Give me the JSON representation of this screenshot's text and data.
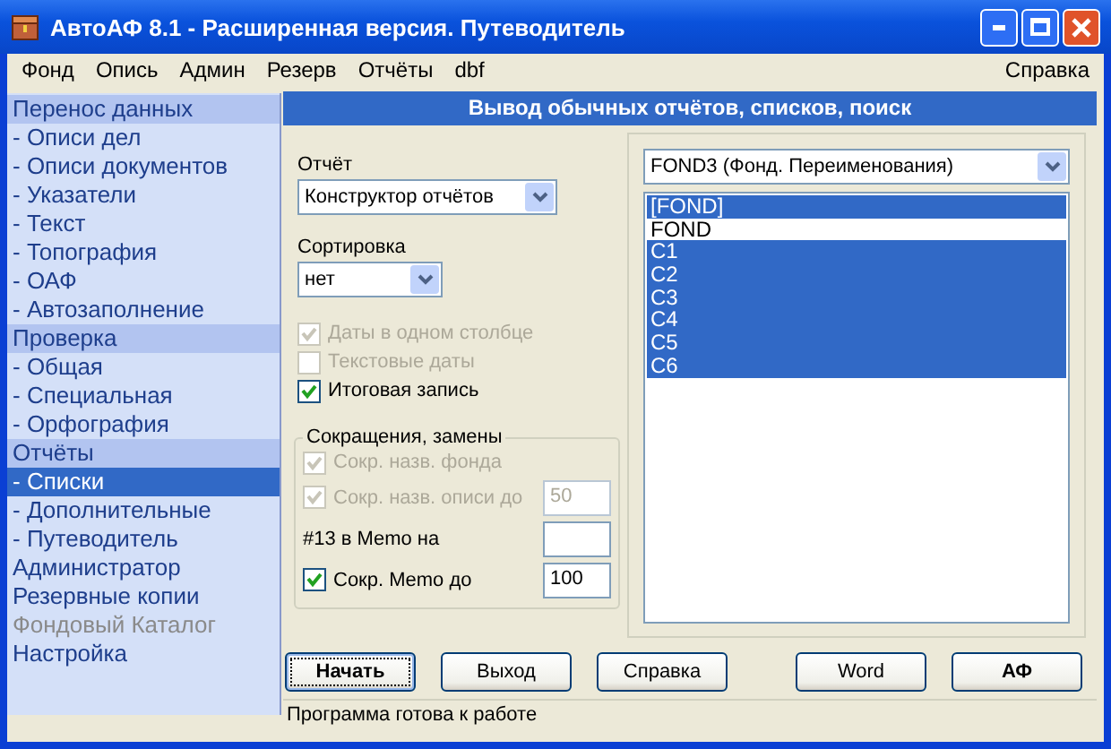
{
  "window": {
    "title": "АвтоАФ 8.1 - Расширенная версия. Путеводитель"
  },
  "menu": {
    "items": [
      "Фонд",
      "Опись",
      "Админ",
      "Резерв",
      "Отчёты",
      "dbf"
    ],
    "help": "Справка"
  },
  "sidebar": {
    "items": [
      {
        "label": "Перенос данных",
        "kind": "header",
        "selected": false,
        "disabled": false
      },
      {
        "label": "- Описи дел",
        "kind": "item",
        "selected": false,
        "disabled": false
      },
      {
        "label": "- Описи документов",
        "kind": "item",
        "selected": false,
        "disabled": false
      },
      {
        "label": "- Указатели",
        "kind": "item",
        "selected": false,
        "disabled": false
      },
      {
        "label": "- Текст",
        "kind": "item",
        "selected": false,
        "disabled": false
      },
      {
        "label": "- Топография",
        "kind": "item",
        "selected": false,
        "disabled": false
      },
      {
        "label": "- ОАФ",
        "kind": "item",
        "selected": false,
        "disabled": false
      },
      {
        "label": "- Автозаполнение",
        "kind": "item",
        "selected": false,
        "disabled": false
      },
      {
        "label": "Проверка",
        "kind": "header",
        "selected": false,
        "disabled": false
      },
      {
        "label": "- Общая",
        "kind": "item",
        "selected": false,
        "disabled": false
      },
      {
        "label": "- Специальная",
        "kind": "item",
        "selected": false,
        "disabled": false
      },
      {
        "label": "- Орфография",
        "kind": "item",
        "selected": false,
        "disabled": false
      },
      {
        "label": "Отчёты",
        "kind": "header",
        "selected": false,
        "disabled": false
      },
      {
        "label": "- Списки",
        "kind": "item",
        "selected": true,
        "disabled": false
      },
      {
        "label": "- Дополнительные",
        "kind": "item",
        "selected": false,
        "disabled": false
      },
      {
        "label": "- Путеводитель",
        "kind": "item",
        "selected": false,
        "disabled": false
      },
      {
        "label": "Администратор",
        "kind": "item",
        "selected": false,
        "disabled": false
      },
      {
        "label": "Резервные копии",
        "kind": "item",
        "selected": false,
        "disabled": false
      },
      {
        "label": "Фондовый Каталог",
        "kind": "item",
        "selected": false,
        "disabled": true
      },
      {
        "label": "Настройка",
        "kind": "item",
        "selected": false,
        "disabled": false
      }
    ]
  },
  "header": "Вывод обычных отчётов, списков, поиск",
  "report": {
    "label": "Отчёт",
    "value": "Конструктор отчётов"
  },
  "sorting": {
    "label": "Сортировка",
    "value": "нет"
  },
  "options": [
    {
      "label": "Даты в одном столбце",
      "checked": true,
      "disabled": true
    },
    {
      "label": "Текстовые даты",
      "checked": false,
      "disabled": true
    },
    {
      "label": "Итоговая запись",
      "checked": true,
      "disabled": false
    }
  ],
  "abbreviations": {
    "title": "Сокращения, замены",
    "rows": [
      {
        "kind": "checkbox",
        "label": "Сокр. назв. фонда",
        "checked": true,
        "disabled": true
      },
      {
        "kind": "checkbox",
        "label": "Сокр. назв. описи до",
        "checked": true,
        "disabled": true,
        "field": {
          "value": "50",
          "disabled": true
        }
      },
      {
        "kind": "label",
        "label": "#13 в Memo на",
        "field": {}
      },
      {
        "kind": "checkbox",
        "label": "Сокр. Memo до",
        "checked": true,
        "disabled": false,
        "field": {
          "value": "100",
          "disabled": false
        }
      }
    ]
  },
  "table_select": {
    "value": "FOND3 (Фонд. Переименования)"
  },
  "fields_list": [
    {
      "label": "[FOND]",
      "selected": true
    },
    {
      "label": "FOND",
      "selected": false
    },
    {
      "label": "C1",
      "selected": true
    },
    {
      "label": "C2",
      "selected": true
    },
    {
      "label": "C3",
      "selected": true
    },
    {
      "label": "C4",
      "selected": true
    },
    {
      "label": "C5",
      "selected": true
    },
    {
      "label": "C6",
      "selected": true
    }
  ],
  "buttons": {
    "main": [
      {
        "label": "Начать",
        "default": true,
        "bold": true
      },
      {
        "label": "Выход",
        "default": false,
        "bold": false
      },
      {
        "label": "Справка",
        "default": false,
        "bold": false
      }
    ],
    "extra": [
      {
        "label": "Word",
        "default": false,
        "bold": false
      },
      {
        "label": "АФ",
        "default": false,
        "bold": true
      }
    ]
  },
  "status_bar": "Программа готова к работе"
}
